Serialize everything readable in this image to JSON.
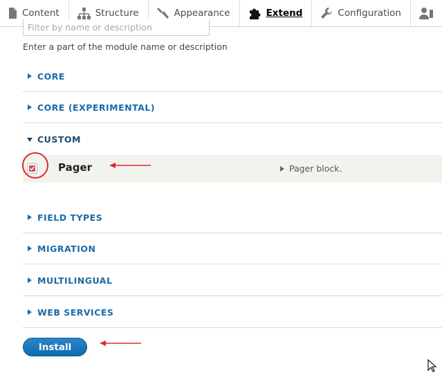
{
  "toolbar": {
    "items": [
      {
        "label": "Content",
        "icon": "document-icon"
      },
      {
        "label": "Structure",
        "icon": "sitemap-icon"
      },
      {
        "label": "Appearance",
        "icon": "paintbrush-icon"
      },
      {
        "label": "Extend",
        "icon": "puzzle-icon"
      },
      {
        "label": "Configuration",
        "icon": "wrench-icon"
      },
      {
        "label": "People",
        "icon": "people-icon"
      }
    ],
    "active": "Extend"
  },
  "filter": {
    "placeholder": "Filter by name or description",
    "help": "Enter a part of the module name or description"
  },
  "groups": {
    "core": "CORE",
    "core_experimental": "CORE (EXPERIMENTAL)",
    "custom": "CUSTOM",
    "field_types": "FIELD TYPES",
    "migration": "MIGRATION",
    "multilingual": "MULTILINGUAL",
    "web_services": "WEB SERVICES"
  },
  "module": {
    "name": "Pager",
    "description": "Pager block.",
    "checked": true
  },
  "install_label": "Install",
  "colors": {
    "link": "#1a6aa8",
    "button": "#1a73b8",
    "annotation": "#dd2a2a",
    "checkbox_checked": "#d24a5a"
  }
}
